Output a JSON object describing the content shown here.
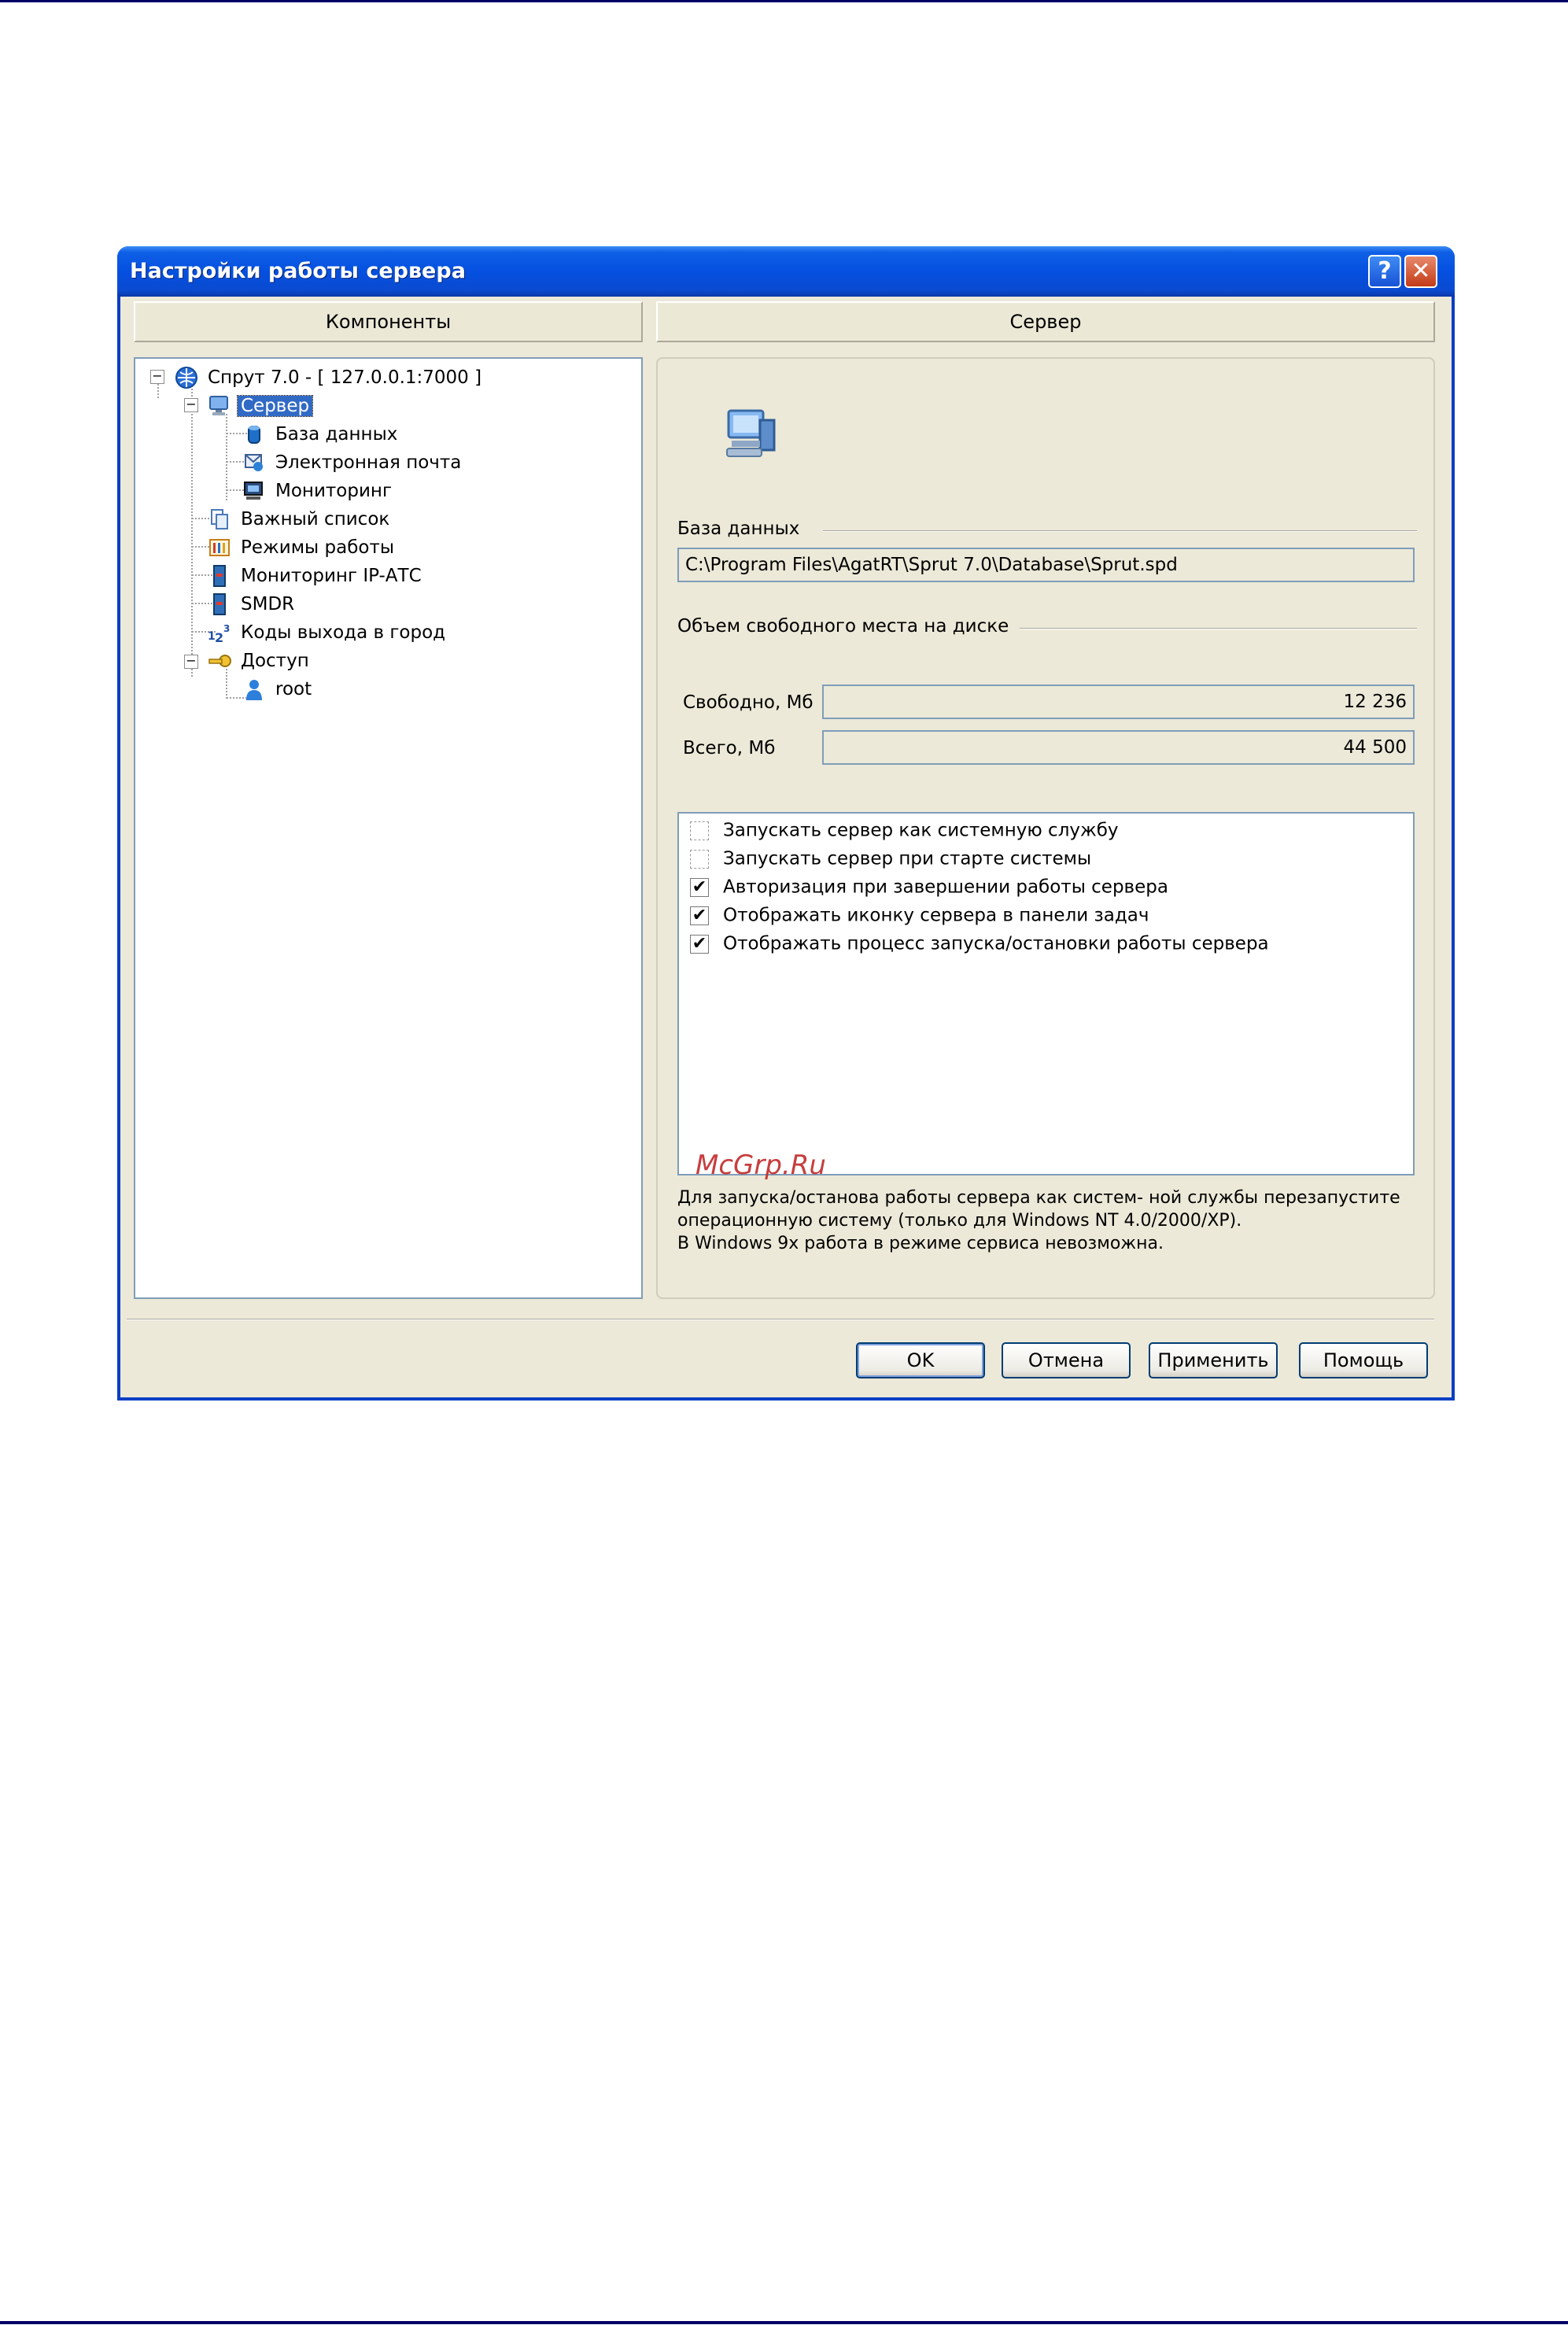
{
  "window": {
    "title": "Настройки работы сервера",
    "help_button": "?",
    "close_button": "✕"
  },
  "columns": {
    "left": "Компоненты",
    "right": "Сервер"
  },
  "tree": {
    "items": [
      {
        "label": "Спрут 7.0 - [ 127.0.0.1:7000 ]",
        "icon": "network-globe-icon"
      },
      {
        "label": "Сервер",
        "icon": "computer-icon",
        "selected": true
      },
      {
        "label": "База данных",
        "icon": "database-icon"
      },
      {
        "label": "Электронная почта",
        "icon": "email-icon"
      },
      {
        "label": "Мониторинг",
        "icon": "monitor-icon"
      },
      {
        "label": "Важный список",
        "icon": "list-icon"
      },
      {
        "label": "Режимы работы",
        "icon": "calendar-icon"
      },
      {
        "label": "Мониторинг IP-АТС",
        "icon": "device-icon"
      },
      {
        "label": "SMDR",
        "icon": "device-icon"
      },
      {
        "label": "Коды выхода в город",
        "icon": "numbers-icon"
      },
      {
        "label": "Доступ",
        "icon": "key-icon"
      },
      {
        "label": "root",
        "icon": "user-icon"
      }
    ]
  },
  "server_panel": {
    "database_group_label": "База данных",
    "database_path": "C:\\Program Files\\AgatRT\\Sprut 7.0\\Database\\Sprut.spd",
    "disk_group_label": "Объем свободного места на диске",
    "free_label": "Свободно, Мб",
    "free_value": "12 236",
    "total_label": "Всего, Мб",
    "total_value": "44 500",
    "options": [
      {
        "label": "Запускать сервер как системную службу",
        "checked": false
      },
      {
        "label": "Запускать сервер при старте системы",
        "checked": false
      },
      {
        "label": "Авторизация при завершении работы сервера",
        "checked": true
      },
      {
        "label": "Отображать иконку сервера в панели задач",
        "checked": true
      },
      {
        "label": "Отображать процесс запуска/остановки работы сервера",
        "checked": true
      }
    ],
    "note_line1": "Для запуска/останова работы сервера как систем- ной службы перезапустите",
    "note_line2": "операционную систему (только для Windows NT 4.0/2000/XP).",
    "note_line3": "В Windows 9x работа в режиме сервиса невозможна."
  },
  "watermark": "McGrp.Ru",
  "buttons": {
    "ok": "OK",
    "cancel": "Отмена",
    "apply": "Применить",
    "help": "Помощь"
  },
  "colors": {
    "titlebar": "#0550e0",
    "selection": "#316ac5",
    "dialog_bg": "#ece9d8"
  }
}
